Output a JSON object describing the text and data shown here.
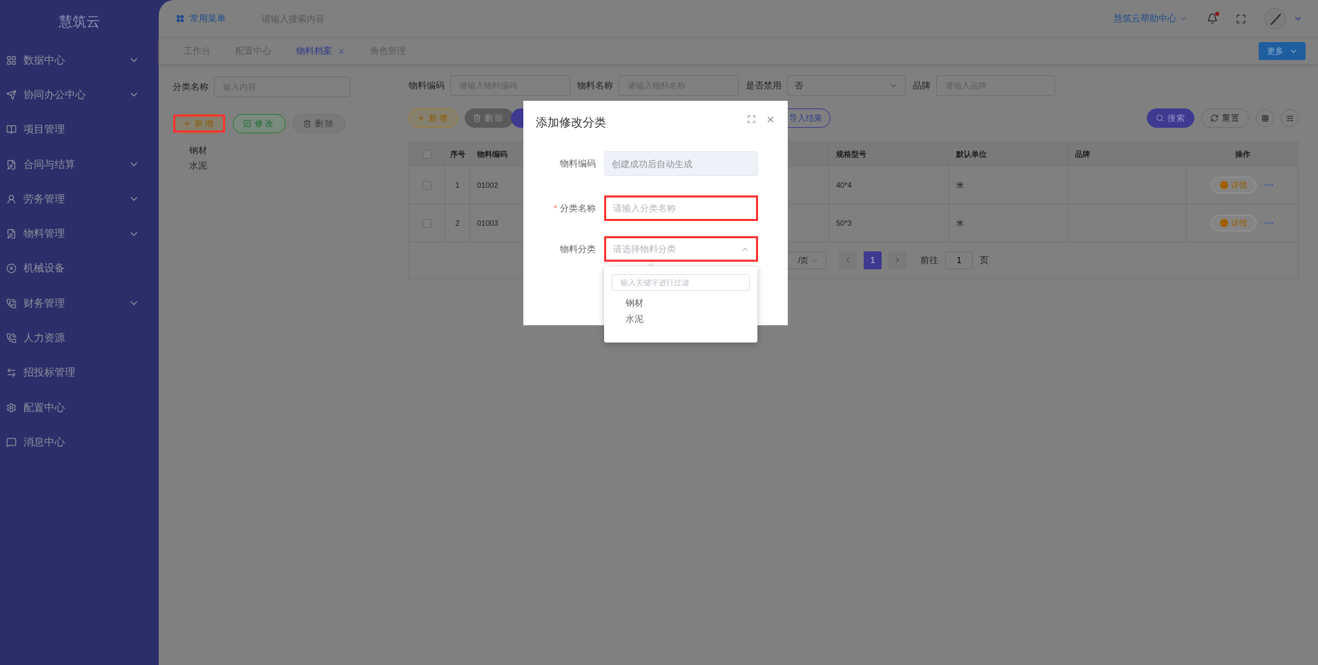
{
  "sidebar": {
    "logo": "慧筑云",
    "items": [
      {
        "label": "数据中心",
        "expandable": true
      },
      {
        "label": "协同办公中心",
        "expandable": true
      },
      {
        "label": "项目管理",
        "expandable": false
      },
      {
        "label": "合同与结算",
        "expandable": true
      },
      {
        "label": "劳务管理",
        "expandable": true
      },
      {
        "label": "物料管理",
        "expandable": true
      },
      {
        "label": "机械设备",
        "expandable": false
      },
      {
        "label": "财务管理",
        "expandable": true
      },
      {
        "label": "人力资源",
        "expandable": false
      },
      {
        "label": "招投标管理",
        "expandable": false
      },
      {
        "label": "配置中心",
        "expandable": false
      },
      {
        "label": "消息中心",
        "expandable": false
      }
    ]
  },
  "header": {
    "menu_button": "常用菜单",
    "search": {
      "placeholder": "请输入搜索内容"
    },
    "help_link": "慧筑云帮助中心",
    "notification_dot": true
  },
  "tabs": [
    {
      "label": "工作台",
      "selected": false,
      "closable": false
    },
    {
      "label": "配置中心",
      "selected": false,
      "closable": false
    },
    {
      "label": "物料档案",
      "selected": true,
      "closable": true
    },
    {
      "label": "角色管理",
      "selected": false,
      "closable": false
    }
  ],
  "more_button": "更多",
  "category_panel": {
    "search": {
      "label": "分类名称",
      "placeholder": "输入内容"
    },
    "buttons": [
      {
        "label": "新增",
        "kind": "add",
        "highlighted": true
      },
      {
        "label": "修改",
        "kind": "edit",
        "highlighted": false
      },
      {
        "label": "删除",
        "kind": "delete",
        "highlighted": false
      }
    ],
    "tree": [
      {
        "label": "钢材"
      },
      {
        "label": "水泥"
      }
    ]
  },
  "filters": [
    {
      "label": "物料编码",
      "placeholder": "请输入物料编码",
      "kind": "input"
    },
    {
      "label": "物料名称",
      "placeholder": "请输入物料名称",
      "kind": "input"
    },
    {
      "label": "是否禁用",
      "value": "否",
      "kind": "select"
    },
    {
      "label": "品牌",
      "placeholder": "请输入品牌",
      "kind": "input"
    }
  ],
  "toolbar": {
    "buttons": [
      {
        "label": "新增",
        "kind": "add"
      },
      {
        "label": "删除",
        "kind": "delete"
      },
      {
        "kind": "import"
      },
      {
        "label": "导入结果",
        "kind": "outline"
      }
    ],
    "right_buttons": [
      {
        "label": "搜索",
        "kind": "search"
      },
      {
        "label": "重置",
        "kind": "reset"
      }
    ]
  },
  "table": {
    "all_checked": false,
    "columns": [
      {
        "label": "序号"
      },
      {
        "label": "物料编码"
      },
      {
        "label": "规格型号"
      },
      {
        "label": "默认单位"
      },
      {
        "label": "品牌"
      },
      {
        "label": "操作"
      }
    ],
    "rows": [
      {
        "checked": false,
        "seq": "1",
        "code": "01002",
        "spec": "40*4",
        "unit": "米",
        "action": "详情"
      },
      {
        "checked": false,
        "seq": "2",
        "code": "01003",
        "spec": "50*3",
        "unit": "米",
        "action": "详情"
      }
    ]
  },
  "pagination": {
    "page_size": "/页",
    "pages": [
      {
        "label": "1",
        "selected": true
      }
    ],
    "goto_label": "前往",
    "goto_value": "1",
    "goto_suffix": "页"
  },
  "dialog": {
    "title": "添加修改分类",
    "required_mark": "*",
    "fields": [
      {
        "label": "物料编码",
        "placeholder": "创建成功后自动生成",
        "kind": "input",
        "disabled": true,
        "required": false,
        "highlighted": false
      },
      {
        "label": "分类名称",
        "placeholder": "请输入分类名称",
        "kind": "input",
        "disabled": false,
        "required": true,
        "highlighted": true
      },
      {
        "label": "物料分类",
        "placeholder": "请选择物料分类",
        "kind": "select",
        "disabled": false,
        "required": false,
        "highlighted": true,
        "expanded": true
      }
    ],
    "dropdown": {
      "filter_placeholder": "输入关键字进行过滤",
      "options": [
        {
          "label": "钢材"
        },
        {
          "label": "水泥"
        }
      ]
    }
  }
}
